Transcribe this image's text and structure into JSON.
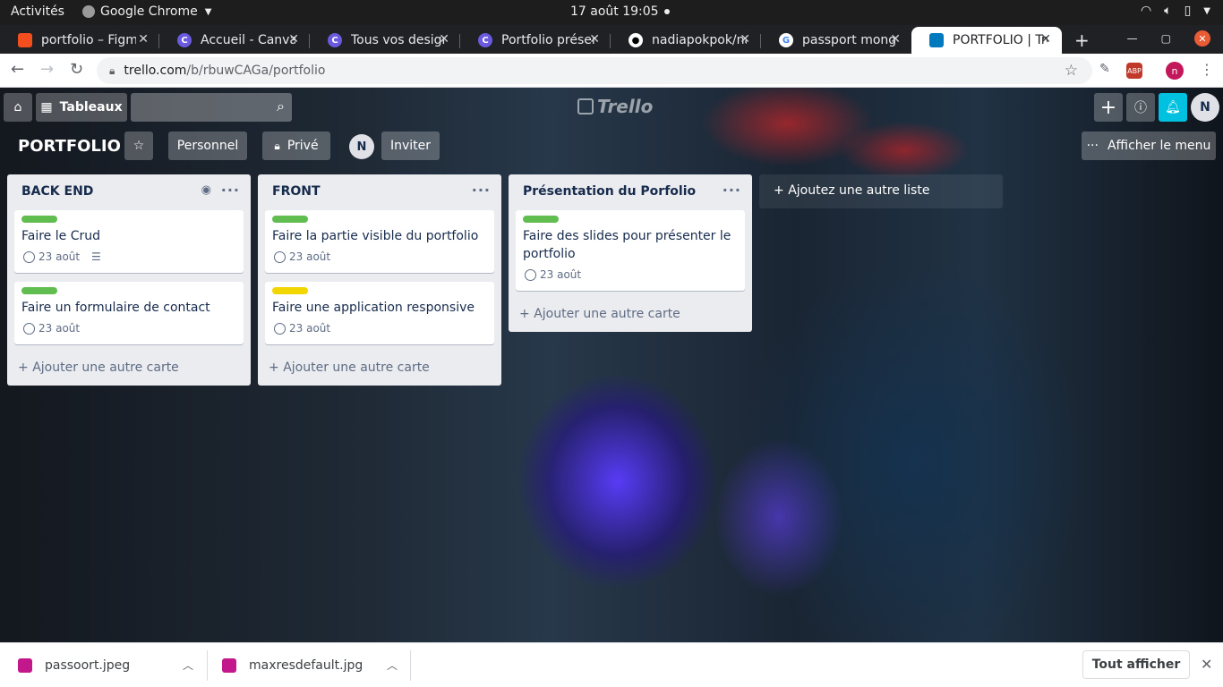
{
  "system": {
    "activities": "Activités",
    "app_name": "Google Chrome",
    "clock": "17 août  19:05"
  },
  "tabs": [
    {
      "title": "portfolio – Figma",
      "favicon": "figma-icon",
      "color": "#f24e1e"
    },
    {
      "title": "Accueil - Canva",
      "favicon": "canva-icon",
      "color": "#6a5ae0"
    },
    {
      "title": "Tous vos designs",
      "favicon": "canva-icon",
      "color": "#6a5ae0"
    },
    {
      "title": "Portfolio présentation",
      "favicon": "canva-icon",
      "color": "#6a5ae0"
    },
    {
      "title": "nadiapokpok/nadia",
      "favicon": "github-icon",
      "color": "#333333"
    },
    {
      "title": "passport mongoose",
      "favicon": "google-icon",
      "color": "#ffffff"
    },
    {
      "title": "PORTFOLIO | Trello",
      "favicon": "trello-icon",
      "color": "#0079bf"
    }
  ],
  "address": {
    "host": "trello.com",
    "path": "/b/rbuwCAGa/portfolio",
    "profile_initial": "n",
    "abp_label": "ABP"
  },
  "trello": {
    "boards_label": "Tableaux",
    "logo": "Trello",
    "user_initial": "N",
    "board_title": "PORTFOLIO",
    "team_label": "Personnel",
    "visibility_label": "Privé",
    "member_initial": "N",
    "invite_label": "Inviter",
    "menu_label": "Afficher le menu",
    "add_list": "Ajoutez une autre liste",
    "add_card": "Ajouter une autre carte",
    "lists": [
      {
        "title": "BACK END",
        "cards": [
          {
            "title": "Faire le Crud",
            "due": "23 août",
            "label_color": "#61bd4f"
          },
          {
            "title": "Faire un formulaire de contact",
            "due": "23 août",
            "label_color": "#61bd4f"
          }
        ]
      },
      {
        "title": "FRONT",
        "cards": [
          {
            "title": "Faire la partie visible du portfolio",
            "due": "23 août",
            "label_color": "#61bd4f"
          },
          {
            "title": "Faire une application responsive",
            "due": "23 août",
            "label_color": "#f2d600"
          }
        ]
      },
      {
        "title": "Présentation du Porfolio",
        "cards": [
          {
            "title": "Faire des slides pour présenter le portfolio",
            "due": "23 août",
            "label_color": "#61bd4f"
          }
        ]
      }
    ]
  },
  "downloads": [
    {
      "name": "passoort.jpeg"
    },
    {
      "name": "maxresdefault.jpg"
    }
  ],
  "downloads_show_all": "Tout afficher"
}
